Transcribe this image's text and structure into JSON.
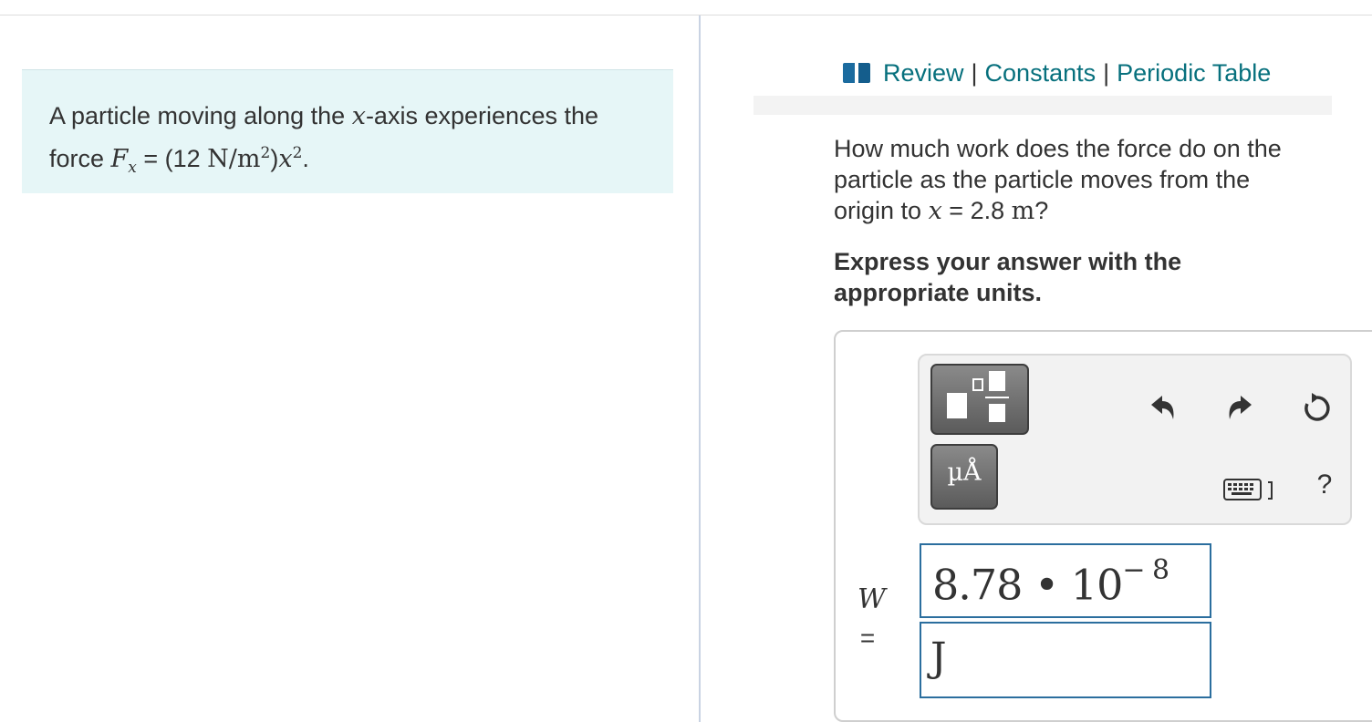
{
  "problem": {
    "text_part1": "A particle moving along the ",
    "var_x": "x",
    "text_part2": "-axis experiences the",
    "text_force": "force ",
    "force_symbol": "F",
    "force_sub": "x",
    "equals": " = ",
    "open": "(12 ",
    "units": "N/m",
    "units_exp": "2",
    "close": ")",
    "x_var": "x",
    "x_exp": "2",
    "period": "."
  },
  "resources": {
    "icon": "book-icon",
    "review": "Review",
    "constants": "Constants",
    "periodic_table": "Periodic Table",
    "separator": "|"
  },
  "question": {
    "line1": "How much work does the force do on the",
    "line2": "particle as the particle moves from the",
    "line3_pre": "origin to ",
    "var": "x",
    "eq": " = 2.8 ",
    "unit": "m",
    "end": "?"
  },
  "instruction": {
    "line1": "Express your answer with the",
    "line2": "appropriate units."
  },
  "toolbar": {
    "units_glyph": "µÅ",
    "help": "?",
    "icons": [
      "fraction-template-icon",
      "units-template-icon",
      "undo-icon",
      "redo-icon",
      "reset-icon",
      "keyboard-icon",
      "help-icon"
    ]
  },
  "answer": {
    "label": "W",
    "equals": "=",
    "mantissa": "8.78 • 10",
    "exponent": "− 8",
    "units": "J"
  },
  "colors": {
    "link": "#07707d",
    "problem_bg": "#e6f6f7",
    "input_border": "#2b6e9e"
  }
}
